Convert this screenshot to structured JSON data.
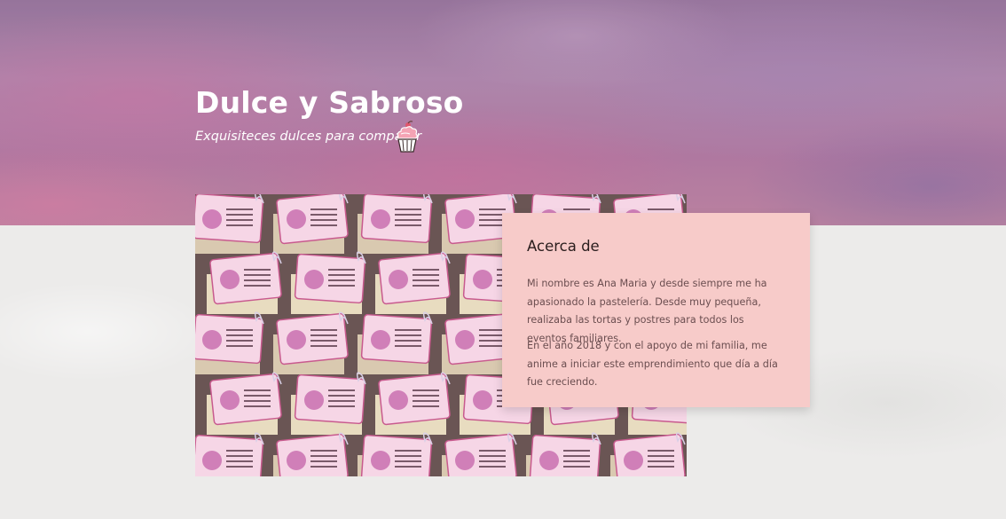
{
  "hero": {
    "title": "Dulce y Sabroso",
    "subtitle": "Exquisiteces dulces para compartir",
    "icon": "cupcake-icon"
  },
  "photo": {
    "alt": "Paquetes de dulces con etiquetas rosadas"
  },
  "about": {
    "heading": "Acerca de",
    "paragraph_1": "Mi nombre es Ana Maria y desde siempre me ha apasionado la pastelería. Desde muy pequeña, realizaba las tortas y postres para todos los eventos familiares.",
    "paragraph_2": "En el año 2018 y con el apoyo de mi familia, me anime a iniciar este emprendimiento que día a día fue creciendo."
  },
  "colors": {
    "card_background": "#f7cbc9",
    "hero_tone": "#b48eb4",
    "page_background": "#ecebea"
  }
}
